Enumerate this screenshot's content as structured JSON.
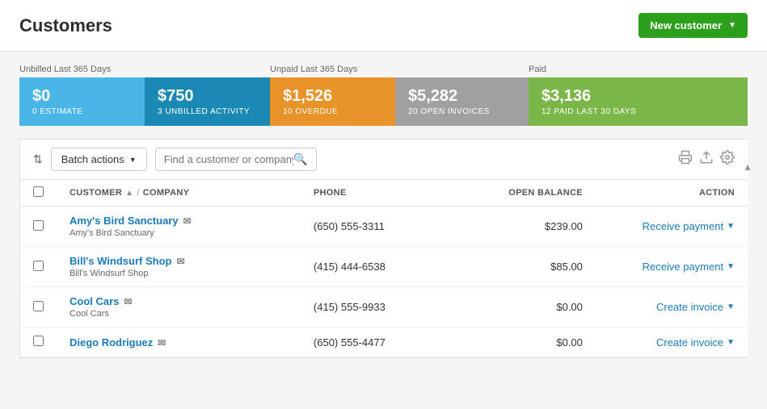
{
  "header": {
    "title": "Customers",
    "new_customer_btn": "New customer"
  },
  "stats": {
    "section1_label": "Unbilled Last 365 Days",
    "section2_label": "Unpaid Last 365 Days",
    "section3_label": "Paid",
    "bars": [
      {
        "amount": "$0",
        "label": "0 ESTIMATE",
        "color": "blue1"
      },
      {
        "amount": "$750",
        "label": "3 UNBILLED ACTIVITY",
        "color": "blue2"
      },
      {
        "amount": "$1,526",
        "label": "10 OVERDUE",
        "color": "orange"
      },
      {
        "amount": "$5,282",
        "label": "20 OPEN INVOICES",
        "color": "gray"
      },
      {
        "amount": "$3,136",
        "label": "12 PAID LAST 30 DAYS",
        "color": "green"
      }
    ]
  },
  "toolbar": {
    "batch_btn": "Batch actions",
    "search_placeholder": "Find a customer or company"
  },
  "table": {
    "headers": {
      "customer": "CUSTOMER",
      "company": "COMPANY",
      "phone": "PHONE",
      "open_balance": "OPEN BALANCE",
      "action": "ACTION"
    },
    "rows": [
      {
        "name": "Amy's Bird Sanctuary",
        "company": "Amy's Bird Sanctuary",
        "phone": "(650) 555-3311",
        "balance": "$239.00",
        "action": "Receive payment",
        "has_email": true
      },
      {
        "name": "Bill's Windsurf Shop",
        "company": "Bill's Windsurf Shop",
        "phone": "(415) 444-6538",
        "balance": "$85.00",
        "action": "Receive payment",
        "has_email": true
      },
      {
        "name": "Cool Cars",
        "company": "Cool Cars",
        "phone": "(415) 555-9933",
        "balance": "$0.00",
        "action": "Create invoice",
        "has_email": true
      },
      {
        "name": "Diego Rodriguez",
        "company": "",
        "phone": "(650) 555-4477",
        "balance": "$0.00",
        "action": "Create invoice",
        "has_email": true
      }
    ]
  },
  "icons": {
    "sort": "⇅",
    "chevron_down": "▼",
    "search": "🔍",
    "email": "✉",
    "print": "🖨",
    "export": "⬆",
    "settings": "⚙",
    "scroll_up": "▲"
  }
}
